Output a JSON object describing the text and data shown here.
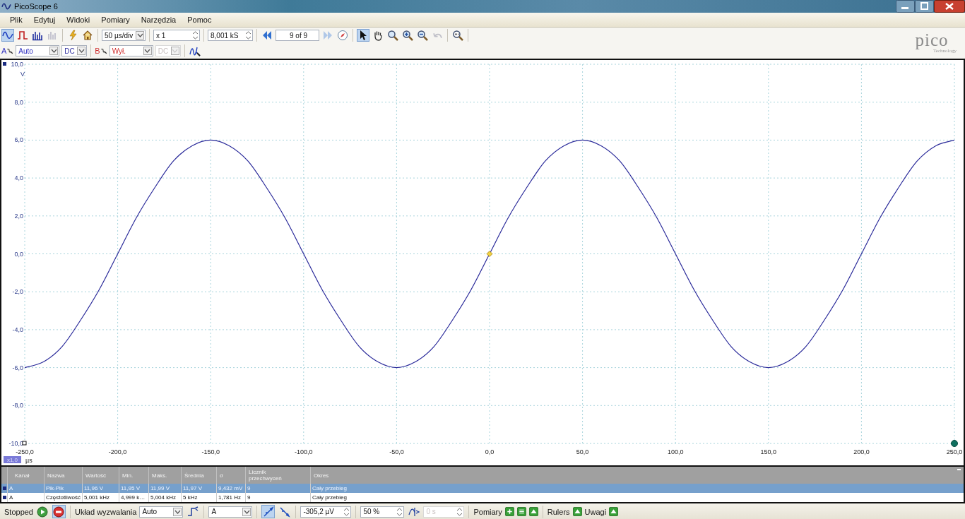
{
  "window": {
    "title": "PicoScope 6"
  },
  "menu": [
    "Plik",
    "Edytuj",
    "Widoki",
    "Pomiary",
    "Narzędzia",
    "Pomoc"
  ],
  "toolbar": {
    "view_modes": [
      {
        "selected": true
      },
      {
        "selected": false
      },
      {
        "selected": false
      }
    ],
    "timebase": "50 µs/div",
    "zoom": "x 1",
    "samples": "8,001 kS",
    "capture": "9 of 9",
    "tools": [
      {
        "selected": true
      },
      {
        "selected": false
      },
      {
        "selected": false
      },
      {
        "selected": false
      },
      {
        "selected": false
      }
    ]
  },
  "channels": [
    {
      "label": "A",
      "color": "#3030c0",
      "range": "Auto",
      "coupling": "DC",
      "disabled": false
    },
    {
      "label": "B",
      "color": "#d03030",
      "range": "Wył.",
      "coupling": "DC",
      "disabled": true
    }
  ],
  "logo": {
    "name": "pico",
    "tagline": "Technology"
  },
  "scope": {
    "y_unit": "V",
    "x_unit": "µs",
    "ruler_badge": "x1,0",
    "chart_data": {
      "type": "line",
      "x": [
        -250,
        -240,
        -230,
        -220,
        -210,
        -200,
        -190,
        -180,
        -170,
        -160,
        -150,
        -140,
        -130,
        -120,
        -110,
        -100,
        -90,
        -80,
        -70,
        -60,
        -50,
        -40,
        -30,
        -20,
        -10,
        0,
        10,
        20,
        30,
        40,
        50,
        60,
        70,
        80,
        90,
        100,
        110,
        120,
        130,
        140,
        150,
        160,
        170,
        180,
        190,
        200,
        210,
        220,
        230,
        240,
        250
      ],
      "series": [
        {
          "color": "#2a2a9a",
          "values": [
            -6,
            -5.7,
            -4.9,
            -3.5,
            -1.9,
            0,
            1.9,
            3.5,
            4.9,
            5.7,
            6,
            5.7,
            4.9,
            3.5,
            1.9,
            0,
            -1.9,
            -3.5,
            -4.9,
            -5.7,
            -6,
            -5.7,
            -4.9,
            -3.5,
            -1.9,
            0,
            1.9,
            3.5,
            4.9,
            5.7,
            6,
            5.7,
            4.9,
            3.5,
            1.9,
            0,
            -1.9,
            -3.5,
            -4.9,
            -5.7,
            -6,
            -5.7,
            -4.9,
            -3.5,
            -1.9,
            0,
            1.9,
            3.5,
            4.9,
            5.7,
            6
          ]
        }
      ],
      "grid": true,
      "xlim": [
        -250,
        250
      ],
      "ylim": [
        -10,
        10
      ],
      "xticks": [
        {
          "value": -250,
          "label": "-250,0"
        },
        {
          "value": -200,
          "label": "-200,0"
        },
        {
          "value": -150,
          "label": "-150,0"
        },
        {
          "value": -100,
          "label": "-100,0"
        },
        {
          "value": -50,
          "label": "-50,0"
        },
        {
          "value": 0,
          "label": "0,0"
        },
        {
          "value": 50,
          "label": "50,0"
        },
        {
          "value": 100,
          "label": "100,0"
        },
        {
          "value": 150,
          "label": "150,0"
        },
        {
          "value": 200,
          "label": "200,0"
        },
        {
          "value": 250,
          "label": "250,0"
        }
      ],
      "yticks": [
        {
          "value": 10,
          "label": "10,0"
        },
        {
          "value": 8,
          "label": "8,0"
        },
        {
          "value": 6,
          "label": "6,0"
        },
        {
          "value": 4,
          "label": "4,0"
        },
        {
          "value": 2,
          "label": "2,0"
        },
        {
          "value": 0,
          "label": "0,0"
        },
        {
          "value": -2,
          "label": "-2,0"
        },
        {
          "value": -4,
          "label": "-4,0"
        },
        {
          "value": -6,
          "label": "-6,0"
        },
        {
          "value": -8,
          "label": "-8,0"
        },
        {
          "value": -10,
          "label": "-10,0"
        }
      ]
    }
  },
  "measurements": {
    "columns": [
      "Kanał",
      "Nazwa",
      "Wartość",
      "Min.",
      "Maks.",
      "Średnia",
      "σ",
      "Licznik przechwyceń",
      "Okres"
    ],
    "rows": [
      {
        "selected": true,
        "cells": [
          "A",
          "Pik-Pik",
          "11,96 V",
          "11,95 V",
          "11,99 V",
          "11,97 V",
          "9,432 mV",
          "9",
          "Cały przebieg"
        ]
      },
      {
        "selected": false,
        "cells": [
          "A",
          "Częstotliwość",
          "5,001 kHz",
          "4,999 k…",
          "5,004 kHz",
          "5 kHz",
          "1,781 Hz",
          "9",
          "Cały przebieg"
        ]
      }
    ]
  },
  "status_bar": {
    "state": "Stopped",
    "trigger_label": "Układ wyzwalania",
    "trigger_mode": "Auto",
    "trigger_source": "A",
    "edges": [
      {
        "selected": true
      },
      {
        "selected": false
      }
    ],
    "threshold": "-305,2 µV",
    "pretrigger": "50 %",
    "delay": "0 s",
    "sections": [
      "Pomiary",
      "Rulers",
      "Uwagi"
    ]
  }
}
